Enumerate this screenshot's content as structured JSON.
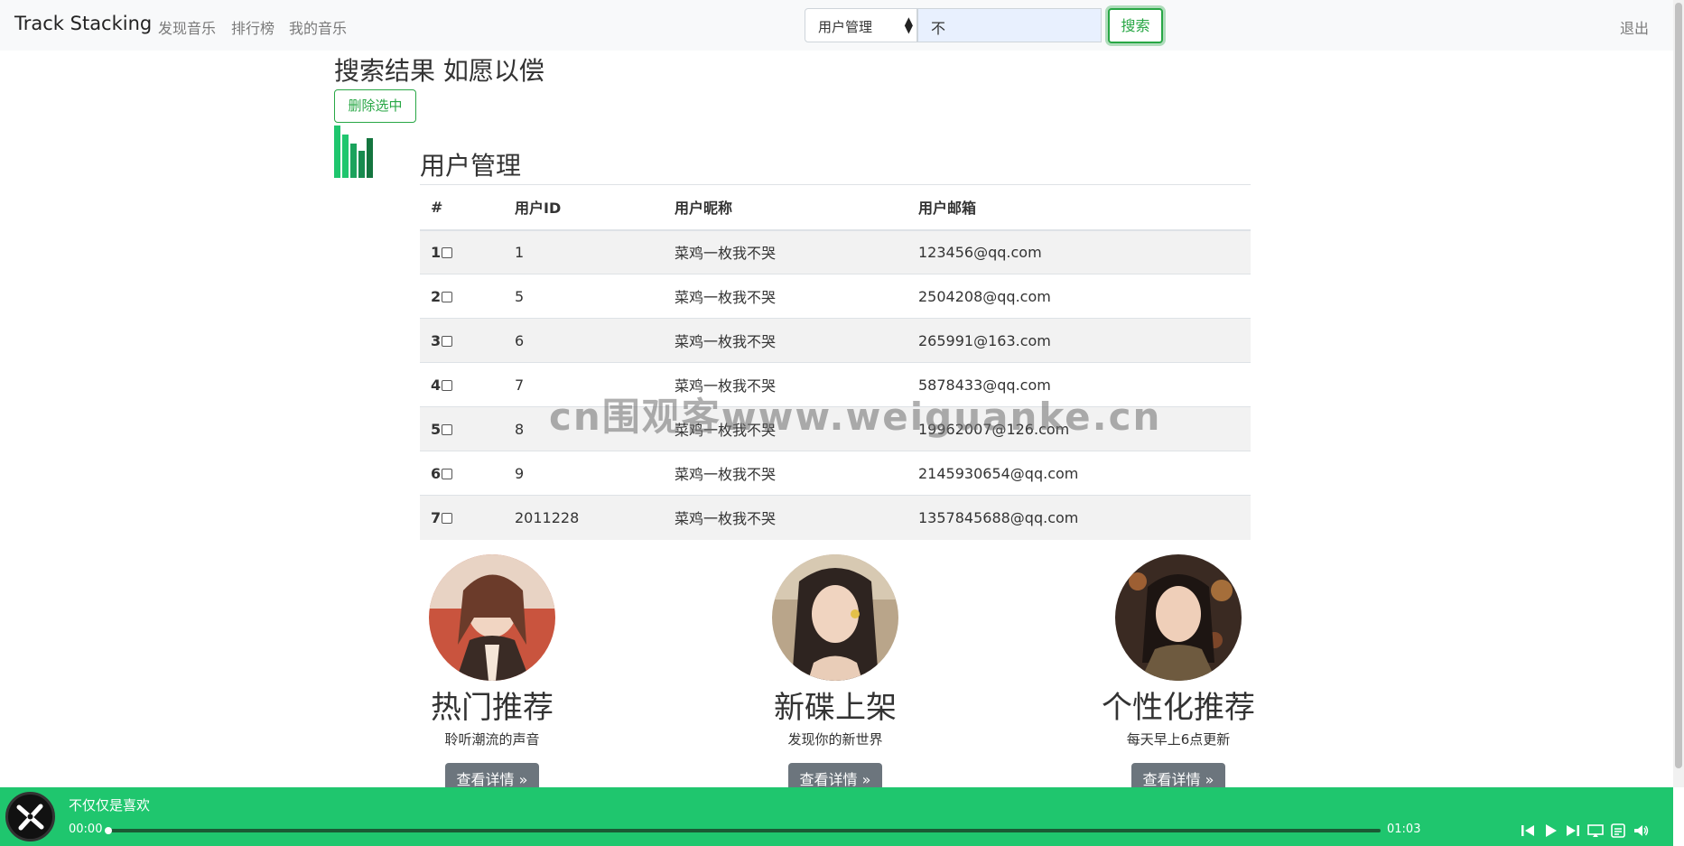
{
  "navbar": {
    "brand": "Track Stacking",
    "links": [
      "发现音乐",
      "排行榜",
      "我的音乐"
    ],
    "search_type": "用户管理",
    "search_value": "不",
    "search_button": "搜索",
    "logout": "退出"
  },
  "main": {
    "page_title": "搜索结果 如愿以偿",
    "delete_button": "删除选中",
    "section_title": "用户管理",
    "table": {
      "headers": [
        "#",
        "用户ID",
        "用户昵称",
        "用户邮箱"
      ],
      "rows": [
        {
          "idx": "1",
          "id": "1",
          "nickname": "菜鸡一枚我不哭",
          "email": "123456@qq.com"
        },
        {
          "idx": "2",
          "id": "5",
          "nickname": "菜鸡一枚我不哭",
          "email": "2504208@qq.com"
        },
        {
          "idx": "3",
          "id": "6",
          "nickname": "菜鸡一枚我不哭",
          "email": "265991@163.com"
        },
        {
          "idx": "4",
          "id": "7",
          "nickname": "菜鸡一枚我不哭",
          "email": "5878433@qq.com"
        },
        {
          "idx": "5",
          "id": "8",
          "nickname": "菜鸡一枚我不哭",
          "email": "19962007@126.com"
        },
        {
          "idx": "6",
          "id": "9",
          "nickname": "菜鸡一枚我不哭",
          "email": "2145930654@qq.com"
        },
        {
          "idx": "7",
          "id": "2011228",
          "nickname": "菜鸡一枚我不哭",
          "email": "1357845688@qq.com"
        }
      ]
    },
    "watermark": "cn围观客www.weiguanke.cn"
  },
  "cards": [
    {
      "title": "热门推荐",
      "subtitle": "聆听潮流的声音",
      "button": "查看详情 »"
    },
    {
      "title": "新碟上架",
      "subtitle": "发现你的新世界",
      "button": "查看详情 »"
    },
    {
      "title": "个性化推荐",
      "subtitle": "每天早上6点更新",
      "button": "查看详情 »"
    }
  ],
  "player": {
    "song_title": "不仅仅是喜欢",
    "current_time": "00:00",
    "total_time": "01:03",
    "progress": 0,
    "controls": [
      "prev-icon",
      "play-icon",
      "next-icon",
      "lyrics-icon",
      "playlist-icon",
      "volume-icon"
    ],
    "accent_color": "#1fc66e"
  },
  "colors": {
    "accent": "#28a745",
    "player_bg": "#1fc66e",
    "button_secondary": "#6c757d"
  }
}
